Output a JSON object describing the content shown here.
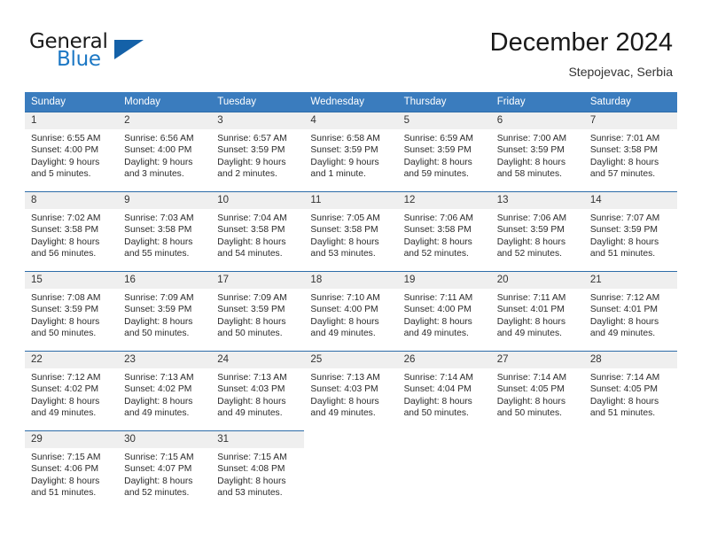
{
  "brand": {
    "name_part1": "General",
    "name_part2": "Blue",
    "triangle_icon": "triangle-logo-icon",
    "accent_color": "#1b77c4",
    "triangle_color": "#1461a8"
  },
  "header": {
    "month_title": "December 2024",
    "location": "Stepojevac, Serbia"
  },
  "calendar": {
    "header_background": "#3a7cbe",
    "daynum_background": "#efefef",
    "row_divider_color": "#2d6ca8",
    "weekday_headers": [
      "Sunday",
      "Monday",
      "Tuesday",
      "Wednesday",
      "Thursday",
      "Friday",
      "Saturday"
    ],
    "weeks": [
      [
        {
          "day": "1",
          "sunrise": "Sunrise: 6:55 AM",
          "sunset": "Sunset: 4:00 PM",
          "daylight1": "Daylight: 9 hours",
          "daylight2": "and 5 minutes."
        },
        {
          "day": "2",
          "sunrise": "Sunrise: 6:56 AM",
          "sunset": "Sunset: 4:00 PM",
          "daylight1": "Daylight: 9 hours",
          "daylight2": "and 3 minutes."
        },
        {
          "day": "3",
          "sunrise": "Sunrise: 6:57 AM",
          "sunset": "Sunset: 3:59 PM",
          "daylight1": "Daylight: 9 hours",
          "daylight2": "and 2 minutes."
        },
        {
          "day": "4",
          "sunrise": "Sunrise: 6:58 AM",
          "sunset": "Sunset: 3:59 PM",
          "daylight1": "Daylight: 9 hours",
          "daylight2": "and 1 minute."
        },
        {
          "day": "5",
          "sunrise": "Sunrise: 6:59 AM",
          "sunset": "Sunset: 3:59 PM",
          "daylight1": "Daylight: 8 hours",
          "daylight2": "and 59 minutes."
        },
        {
          "day": "6",
          "sunrise": "Sunrise: 7:00 AM",
          "sunset": "Sunset: 3:59 PM",
          "daylight1": "Daylight: 8 hours",
          "daylight2": "and 58 minutes."
        },
        {
          "day": "7",
          "sunrise": "Sunrise: 7:01 AM",
          "sunset": "Sunset: 3:58 PM",
          "daylight1": "Daylight: 8 hours",
          "daylight2": "and 57 minutes."
        }
      ],
      [
        {
          "day": "8",
          "sunrise": "Sunrise: 7:02 AM",
          "sunset": "Sunset: 3:58 PM",
          "daylight1": "Daylight: 8 hours",
          "daylight2": "and 56 minutes."
        },
        {
          "day": "9",
          "sunrise": "Sunrise: 7:03 AM",
          "sunset": "Sunset: 3:58 PM",
          "daylight1": "Daylight: 8 hours",
          "daylight2": "and 55 minutes."
        },
        {
          "day": "10",
          "sunrise": "Sunrise: 7:04 AM",
          "sunset": "Sunset: 3:58 PM",
          "daylight1": "Daylight: 8 hours",
          "daylight2": "and 54 minutes."
        },
        {
          "day": "11",
          "sunrise": "Sunrise: 7:05 AM",
          "sunset": "Sunset: 3:58 PM",
          "daylight1": "Daylight: 8 hours",
          "daylight2": "and 53 minutes."
        },
        {
          "day": "12",
          "sunrise": "Sunrise: 7:06 AM",
          "sunset": "Sunset: 3:58 PM",
          "daylight1": "Daylight: 8 hours",
          "daylight2": "and 52 minutes."
        },
        {
          "day": "13",
          "sunrise": "Sunrise: 7:06 AM",
          "sunset": "Sunset: 3:59 PM",
          "daylight1": "Daylight: 8 hours",
          "daylight2": "and 52 minutes."
        },
        {
          "day": "14",
          "sunrise": "Sunrise: 7:07 AM",
          "sunset": "Sunset: 3:59 PM",
          "daylight1": "Daylight: 8 hours",
          "daylight2": "and 51 minutes."
        }
      ],
      [
        {
          "day": "15",
          "sunrise": "Sunrise: 7:08 AM",
          "sunset": "Sunset: 3:59 PM",
          "daylight1": "Daylight: 8 hours",
          "daylight2": "and 50 minutes."
        },
        {
          "day": "16",
          "sunrise": "Sunrise: 7:09 AM",
          "sunset": "Sunset: 3:59 PM",
          "daylight1": "Daylight: 8 hours",
          "daylight2": "and 50 minutes."
        },
        {
          "day": "17",
          "sunrise": "Sunrise: 7:09 AM",
          "sunset": "Sunset: 3:59 PM",
          "daylight1": "Daylight: 8 hours",
          "daylight2": "and 50 minutes."
        },
        {
          "day": "18",
          "sunrise": "Sunrise: 7:10 AM",
          "sunset": "Sunset: 4:00 PM",
          "daylight1": "Daylight: 8 hours",
          "daylight2": "and 49 minutes."
        },
        {
          "day": "19",
          "sunrise": "Sunrise: 7:11 AM",
          "sunset": "Sunset: 4:00 PM",
          "daylight1": "Daylight: 8 hours",
          "daylight2": "and 49 minutes."
        },
        {
          "day": "20",
          "sunrise": "Sunrise: 7:11 AM",
          "sunset": "Sunset: 4:01 PM",
          "daylight1": "Daylight: 8 hours",
          "daylight2": "and 49 minutes."
        },
        {
          "day": "21",
          "sunrise": "Sunrise: 7:12 AM",
          "sunset": "Sunset: 4:01 PM",
          "daylight1": "Daylight: 8 hours",
          "daylight2": "and 49 minutes."
        }
      ],
      [
        {
          "day": "22",
          "sunrise": "Sunrise: 7:12 AM",
          "sunset": "Sunset: 4:02 PM",
          "daylight1": "Daylight: 8 hours",
          "daylight2": "and 49 minutes."
        },
        {
          "day": "23",
          "sunrise": "Sunrise: 7:13 AM",
          "sunset": "Sunset: 4:02 PM",
          "daylight1": "Daylight: 8 hours",
          "daylight2": "and 49 minutes."
        },
        {
          "day": "24",
          "sunrise": "Sunrise: 7:13 AM",
          "sunset": "Sunset: 4:03 PM",
          "daylight1": "Daylight: 8 hours",
          "daylight2": "and 49 minutes."
        },
        {
          "day": "25",
          "sunrise": "Sunrise: 7:13 AM",
          "sunset": "Sunset: 4:03 PM",
          "daylight1": "Daylight: 8 hours",
          "daylight2": "and 49 minutes."
        },
        {
          "day": "26",
          "sunrise": "Sunrise: 7:14 AM",
          "sunset": "Sunset: 4:04 PM",
          "daylight1": "Daylight: 8 hours",
          "daylight2": "and 50 minutes."
        },
        {
          "day": "27",
          "sunrise": "Sunrise: 7:14 AM",
          "sunset": "Sunset: 4:05 PM",
          "daylight1": "Daylight: 8 hours",
          "daylight2": "and 50 minutes."
        },
        {
          "day": "28",
          "sunrise": "Sunrise: 7:14 AM",
          "sunset": "Sunset: 4:05 PM",
          "daylight1": "Daylight: 8 hours",
          "daylight2": "and 51 minutes."
        }
      ],
      [
        {
          "day": "29",
          "sunrise": "Sunrise: 7:15 AM",
          "sunset": "Sunset: 4:06 PM",
          "daylight1": "Daylight: 8 hours",
          "daylight2": "and 51 minutes."
        },
        {
          "day": "30",
          "sunrise": "Sunrise: 7:15 AM",
          "sunset": "Sunset: 4:07 PM",
          "daylight1": "Daylight: 8 hours",
          "daylight2": "and 52 minutes."
        },
        {
          "day": "31",
          "sunrise": "Sunrise: 7:15 AM",
          "sunset": "Sunset: 4:08 PM",
          "daylight1": "Daylight: 8 hours",
          "daylight2": "and 53 minutes."
        },
        {
          "day": "",
          "sunrise": "",
          "sunset": "",
          "daylight1": "",
          "daylight2": ""
        },
        {
          "day": "",
          "sunrise": "",
          "sunset": "",
          "daylight1": "",
          "daylight2": ""
        },
        {
          "day": "",
          "sunrise": "",
          "sunset": "",
          "daylight1": "",
          "daylight2": ""
        },
        {
          "day": "",
          "sunrise": "",
          "sunset": "",
          "daylight1": "",
          "daylight2": ""
        }
      ]
    ]
  }
}
